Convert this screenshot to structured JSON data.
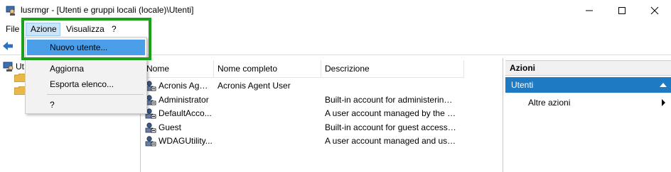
{
  "window": {
    "title": "lusrmgr - [Utenti e gruppi locali (locale)\\Utenti]",
    "icons": {
      "app": "lusrmgr-app-icon",
      "minimize": "minimize-icon",
      "maximize": "maximize-icon",
      "close": "close-icon"
    }
  },
  "menubar": {
    "file": "File",
    "azione": "Azione",
    "visualizza": "Visualizza",
    "help": "?"
  },
  "dropdown": {
    "items": [
      "Nuovo utente...",
      "Aggiorna",
      "Esporta elenco...",
      "?"
    ],
    "highlighted": "Nuovo utente..."
  },
  "tree": {
    "root_label": "Ut"
  },
  "list": {
    "columns": [
      "Nome",
      "Nome completo",
      "Descrizione"
    ],
    "rows": [
      {
        "name": "Acronis Agen...",
        "full_name": "Acronis Agent User",
        "description": ""
      },
      {
        "name": "Administrator",
        "full_name": "",
        "description": "Built-in account for administering ..."
      },
      {
        "name": "DefaultAcco...",
        "full_name": "",
        "description": "A user account managed by the sy..."
      },
      {
        "name": "Guest",
        "full_name": "",
        "description": "Built-in account for guest access t..."
      },
      {
        "name": "WDAGUtility...",
        "full_name": "",
        "description": "A user account managed and used..."
      }
    ]
  },
  "actions": {
    "header": "Azioni",
    "section": "Utenti",
    "more": "Altre azioni"
  },
  "colors": {
    "menu_hover": "#cce4f7",
    "dropdown_highlight": "#4a9ee8",
    "actions_section": "#1f7ac4",
    "annotation_box": "#1aa01a"
  }
}
